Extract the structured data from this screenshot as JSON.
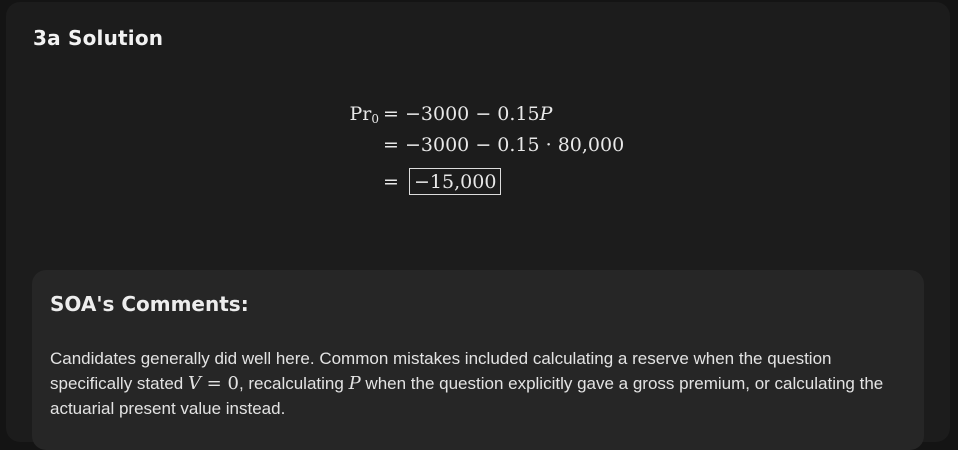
{
  "solution": {
    "title": "3a Solution",
    "equation": {
      "lhs_base": "Pr",
      "lhs_sub": "0",
      "eq_sign": "=",
      "line1": "−3000 − 0.15",
      "line1_var": "P",
      "line2": "−3000 − 0.15 · 80,000",
      "result": "−15,000"
    }
  },
  "comments": {
    "title": "SOA's Comments:",
    "text1": "Candidates generally did well here. Common mistakes included calculating a reserve when the question specifically stated ",
    "math_v": "V",
    "math_eq0": " = 0",
    "text2": ", recalculating ",
    "math_p": "P",
    "text3": " when the question explicitly gave a gross premium, or calculating the actuarial present value instead."
  }
}
